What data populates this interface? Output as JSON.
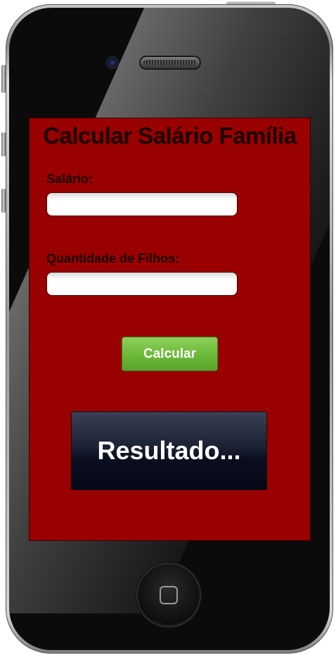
{
  "app": {
    "title": "Calcular Salário Família"
  },
  "form": {
    "salary_label": "Salário:",
    "salary_value": "",
    "children_label": "Quantidade de Filhos:",
    "children_value": "",
    "calculate_label": "Calcular"
  },
  "result": {
    "text": "Resultado..."
  },
  "colors": {
    "screen_background": "#990000",
    "button_green": "#6dbb3a",
    "result_background": "#0a0f1f"
  }
}
